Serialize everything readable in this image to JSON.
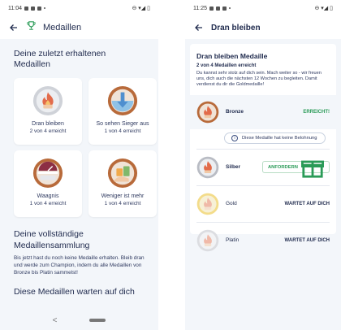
{
  "left": {
    "status": {
      "time": "11:04"
    },
    "appbar": {
      "title": "Medaillen"
    },
    "recent_title": "Deine zuletzt erhaltenen Medaillen",
    "medals": [
      {
        "name": "Dran bleiben",
        "progress": "2 von 4 erreicht",
        "icon": "flame-medal-icon"
      },
      {
        "name": "So sehen Sieger aus",
        "progress": "1 von 4 erreicht",
        "icon": "arrow-down-medal-icon"
      },
      {
        "name": "Waagnis",
        "progress": "1 von 4 erreicht",
        "icon": "scale-medal-icon"
      },
      {
        "name": "Weniger ist mehr",
        "progress": "1 von 4 erreicht",
        "icon": "hand-medal-icon"
      }
    ],
    "collection_title": "Deine vollständige Medaillensammlung",
    "collection_text": "Bis jetzt hast du noch keine Medaille erhalten. Bleib dran und werde zum Champion, indem du alle Medaillen von Bronze bis Platin sammelst!",
    "waiting_title": "Diese Medaillen warten auf dich",
    "nav": {
      "back_glyph": "<"
    }
  },
  "right": {
    "status": {
      "time": "11:25"
    },
    "appbar": {
      "title": "Dran bleiben"
    },
    "card": {
      "title": "Dran bleiben Medaille",
      "subtitle": "2 von 4 Medaillen erreicht",
      "text": "Du kannst sehr stolz auf dich sein. Mach weiter so - wir freuen uns, dich auch die nächsten 12 Wochen zu begleiten. Damit verdienst du dir die Goldmedaille!"
    },
    "levels": [
      {
        "name": "Bronze",
        "status": "ERREICHT!"
      },
      {
        "name": "Silber",
        "status": "ANFORDERN"
      },
      {
        "name": "Gold",
        "status": "WARTET AUF DICH"
      },
      {
        "name": "Platin",
        "status": "WARTET AUF DICH"
      }
    ],
    "info_pill": "Diese Medaille hat keine Belohnung"
  },
  "colors": {
    "accent_green": "#2a9b57",
    "bronze": "#b86a3a",
    "silver": "#b9bcc4",
    "gold": "#e8c24a",
    "platinum": "#d8d8dc",
    "navy_text": "#1f2a4d"
  }
}
